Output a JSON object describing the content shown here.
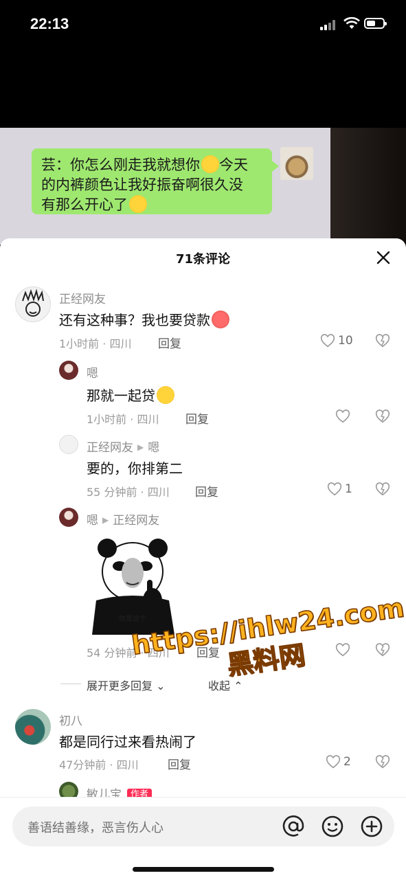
{
  "status_bar": {
    "time": "22:13"
  },
  "photo": {
    "bubble_text_1": "芸：你怎么刚走我就想你",
    "bubble_text_2": "今天",
    "bubble_text_3": "的内裤颜色让我好振奋啊很久没",
    "bubble_text_4": "有那么开心了"
  },
  "sheet": {
    "title": "71条评论"
  },
  "comments": [
    {
      "user": "正经网友",
      "text": "还有这种事？我也要贷款",
      "time": "1小时前 · 四川",
      "reply": "回复",
      "likes": "10"
    },
    {
      "user": "嗯",
      "text": "那就一起贷",
      "time": "1小时前 · 四川",
      "reply": "回复",
      "likes": ""
    },
    {
      "user": "正经网友",
      "reply_to": "嗯",
      "text": "要的，你排第二",
      "time": "55 分钟前 · 四川",
      "reply": "回复",
      "likes": "1"
    },
    {
      "user": "嗯",
      "reply_to": "正经网友",
      "sticker_text": "你是这个",
      "time": "54 分钟前 · 四川",
      "reply": "回复",
      "likes": ""
    },
    {
      "user": "初八",
      "text": "都是同行过来看热闹了",
      "time": "47分钟前 · 四川",
      "reply": "回复",
      "likes": "2"
    },
    {
      "user": "敏儿宝",
      "badge": "作者"
    }
  ],
  "expand": {
    "more": "展开更多回复",
    "collapse": "收起"
  },
  "input": {
    "placeholder": "善语结善缘，恶言伤人心"
  },
  "watermark": {
    "url": "https://ihlw24.com",
    "site": "黑料网"
  },
  "colors": {
    "bubble": "#9fe870",
    "badge": "#fe2c55",
    "watermark": "#ffb21e"
  }
}
